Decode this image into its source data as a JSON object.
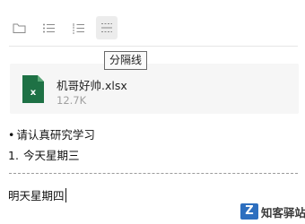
{
  "toolbar": {
    "buttons": [
      {
        "name": "folder",
        "icon": "folder-icon"
      },
      {
        "name": "bulleted-list",
        "icon": "bulleted-list-icon"
      },
      {
        "name": "numbered-list",
        "icon": "numbered-list-icon"
      },
      {
        "name": "divider",
        "icon": "divider-line-icon",
        "active": true
      }
    ],
    "tooltip": "分隔线"
  },
  "attachment": {
    "file_name": "机哥好帅.xlsx",
    "file_size": "12.7K",
    "icon_letter": "x",
    "icon_color": "#1e7145"
  },
  "content": {
    "bullet_marker": "•",
    "bullet_text": "请认真研究学习",
    "ordered_number": "1.",
    "ordered_text": "今天星期三",
    "editing_text": "明天星期四"
  },
  "watermark": {
    "logo": "Z",
    "text": "知客驿站"
  }
}
